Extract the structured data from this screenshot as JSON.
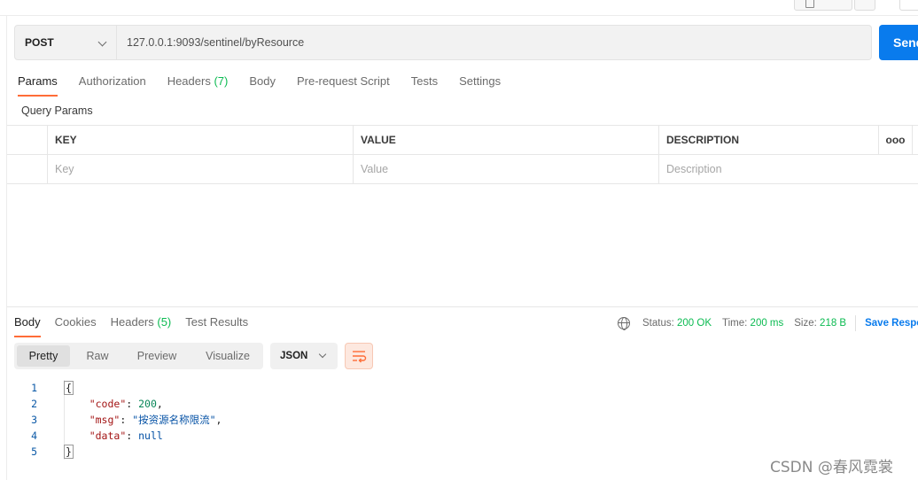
{
  "request": {
    "method": "POST",
    "url": "127.0.0.1:9093/sentinel/byResource",
    "send_label": "Send"
  },
  "request_tabs": [
    {
      "label": "Params",
      "active": true
    },
    {
      "label": "Authorization"
    },
    {
      "label": "Headers",
      "count": "(7)"
    },
    {
      "label": "Body"
    },
    {
      "label": "Pre-request Script"
    },
    {
      "label": "Tests"
    },
    {
      "label": "Settings"
    }
  ],
  "query_params": {
    "title": "Query Params",
    "headers": [
      "KEY",
      "VALUE",
      "DESCRIPTION"
    ],
    "more": "ooo",
    "placeholders": {
      "key": "Key",
      "value": "Value",
      "description": "Description"
    }
  },
  "response_tabs": [
    {
      "label": "Body",
      "active": true
    },
    {
      "label": "Cookies"
    },
    {
      "label": "Headers",
      "count": "(5)"
    },
    {
      "label": "Test Results"
    }
  ],
  "response_status": {
    "status_label": "Status:",
    "status_value": "200 OK",
    "time_label": "Time:",
    "time_value": "200 ms",
    "size_label": "Size:",
    "size_value": "218 B",
    "save_label": "Save Response"
  },
  "view_modes": [
    "Pretty",
    "Raw",
    "Preview",
    "Visualize"
  ],
  "format": "JSON",
  "response_body": {
    "line_numbers": [
      "1",
      "2",
      "3",
      "4",
      "5"
    ],
    "open_brace": "{",
    "close_brace": "}",
    "code_key": "\"code\"",
    "code_value": "200",
    "msg_key": "\"msg\"",
    "msg_value": "\"按资源名称限流\"",
    "data_key": "\"data\"",
    "data_value": "null"
  },
  "watermark": "CSDN @春风霓裳",
  "colors": {
    "accent": "#ff6c37",
    "send": "#097bed",
    "success": "#0cbb52"
  }
}
